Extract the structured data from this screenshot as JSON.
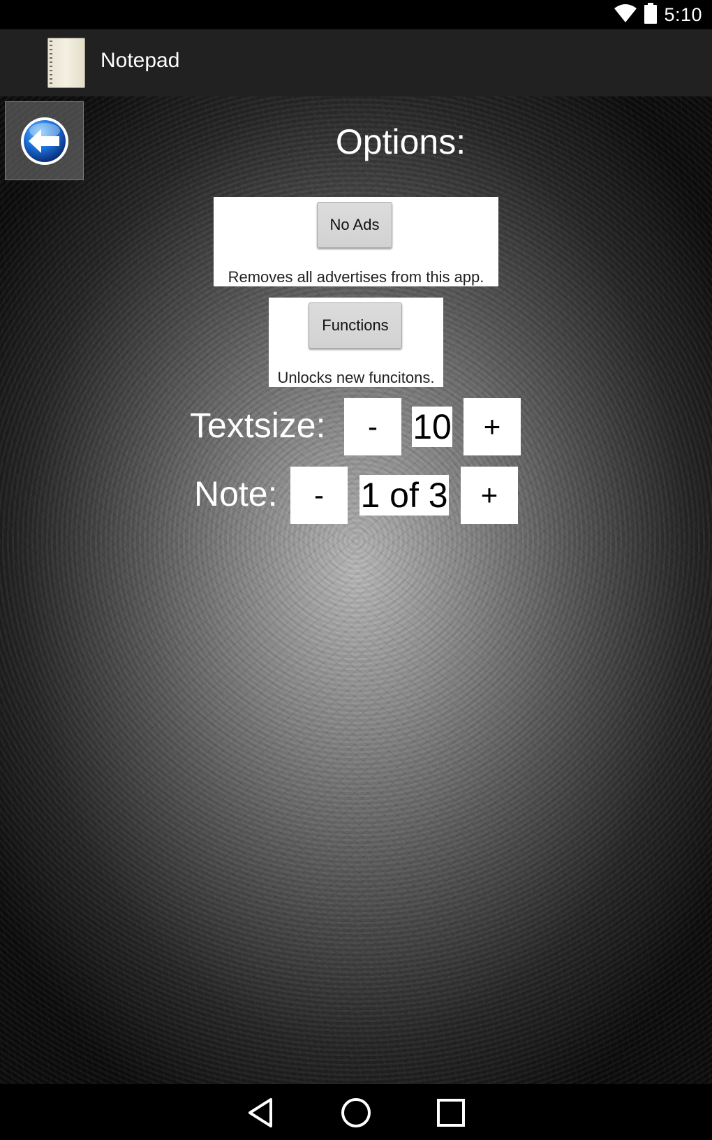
{
  "status_bar": {
    "time": "5:10",
    "icons": [
      "wifi-icon",
      "battery-icon"
    ]
  },
  "action_bar": {
    "title": "Notepad",
    "icon": "notepad-icon"
  },
  "options": {
    "back_icon": "back-arrow-icon",
    "title": "Options:",
    "no_ads": {
      "button_label": "No Ads",
      "description": "Removes all advertises from this app."
    },
    "functions": {
      "button_label": "Functions",
      "description": "Unlocks new funcitons."
    },
    "textsize": {
      "label": "Textsize:",
      "minus": "-",
      "value": "10",
      "plus": "+"
    },
    "note": {
      "label": "Note:",
      "minus": "-",
      "value": "1 of 3",
      "plus": "+"
    }
  },
  "nav_bar": {
    "icons": [
      "back-triangle-icon",
      "home-circle-icon",
      "recents-square-icon"
    ]
  },
  "colors": {
    "accent_blue": "#1a6fd8",
    "action_bar": "#212121"
  }
}
